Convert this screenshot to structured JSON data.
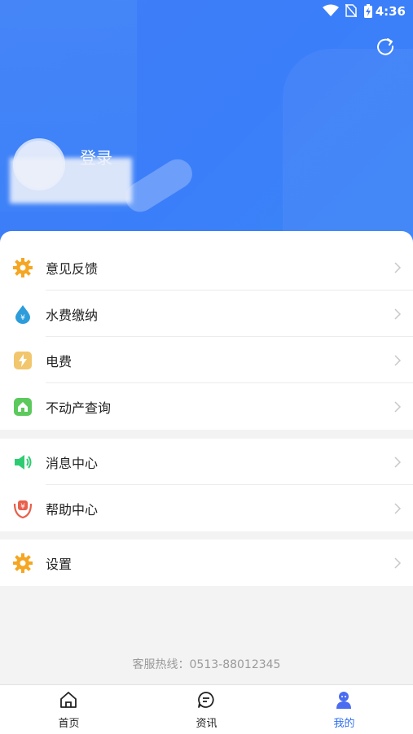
{
  "status_bar": {
    "time": "4:36"
  },
  "profile": {
    "login_label": "登录"
  },
  "menu": {
    "group1": [
      {
        "label": "意见反馈",
        "icon": "gear-orange-icon"
      },
      {
        "label": "水费缴纳",
        "icon": "water-drop-yuan-icon"
      },
      {
        "label": "电费",
        "icon": "lightning-icon"
      },
      {
        "label": "不动产查询",
        "icon": "house-icon"
      }
    ],
    "group2": [
      {
        "label": "消息中心",
        "icon": "speaker-icon"
      },
      {
        "label": "帮助中心",
        "icon": "help-yuan-icon"
      }
    ],
    "group3": [
      {
        "label": "设置",
        "icon": "settings-gear-icon"
      }
    ]
  },
  "hotline": "客服热线：0513-88012345",
  "tabs": [
    {
      "label": "首页",
      "icon": "home-icon"
    },
    {
      "label": "资讯",
      "icon": "chat-icon"
    },
    {
      "label": "我的",
      "icon": "profile-icon"
    }
  ],
  "colors": {
    "accent": "#2f6ff0",
    "header": "#3f7df7"
  }
}
